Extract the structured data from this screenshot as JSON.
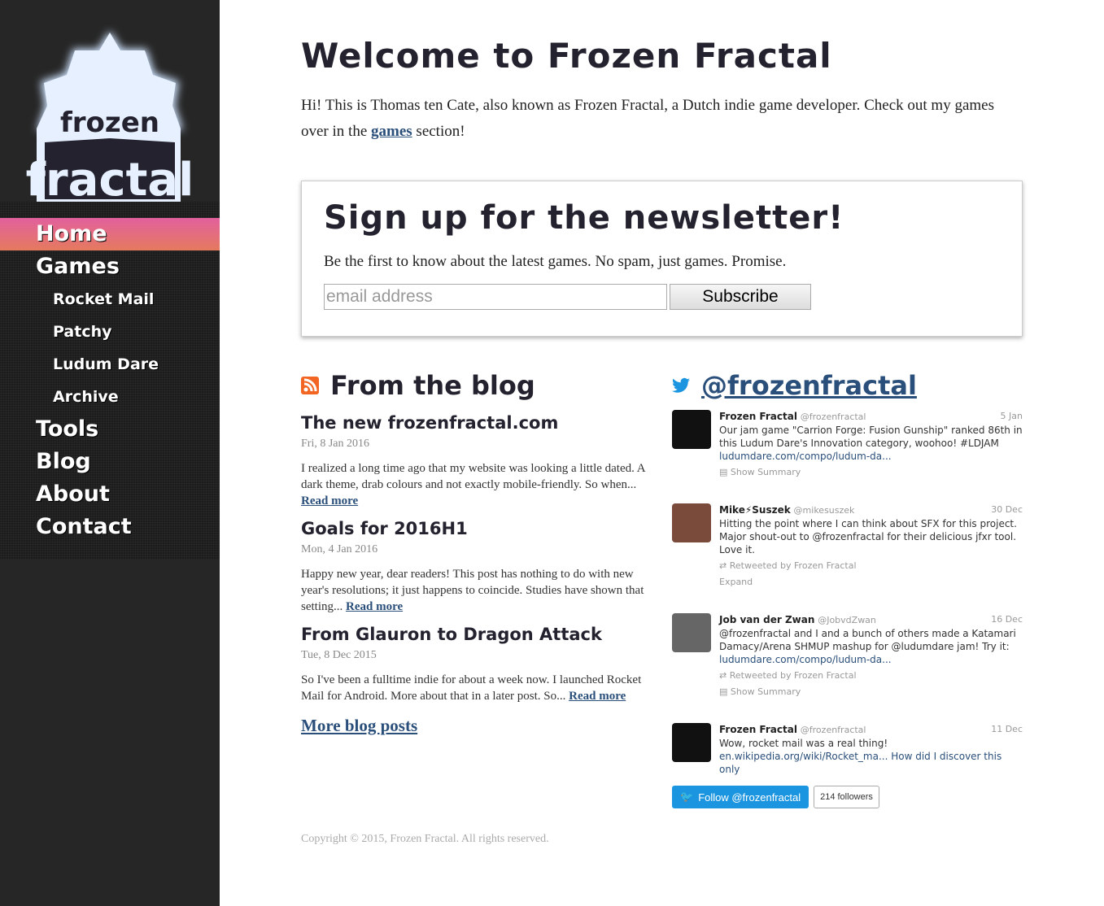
{
  "logo": {
    "line1": "frozen",
    "line2": "fractal"
  },
  "nav": {
    "items": [
      {
        "label": "Home",
        "active": true
      },
      {
        "label": "Games"
      },
      {
        "label": "Rocket Mail",
        "sub": true
      },
      {
        "label": "Patchy",
        "sub": true
      },
      {
        "label": "Ludum Dare",
        "sub": true
      },
      {
        "label": "Archive",
        "sub": true
      },
      {
        "label": "Tools"
      },
      {
        "label": "Blog"
      },
      {
        "label": "About"
      },
      {
        "label": "Contact"
      }
    ]
  },
  "page": {
    "title": "Welcome to Frozen Fractal",
    "intro_before": "Hi! This is Thomas ten Cate, also known as Frozen Fractal, a Dutch indie game developer. Check out my games over in the ",
    "intro_link": "games",
    "intro_after": " section!"
  },
  "newsletter": {
    "title": "Sign up for the newsletter!",
    "text": "Be the first to know about the latest games. No spam, just games. Promise.",
    "placeholder": "email address",
    "button": "Subscribe"
  },
  "blog": {
    "title": "From the blog",
    "posts": [
      {
        "title": "The new frozenfractal.com",
        "date": "Fri, 8 Jan 2016",
        "excerpt": "I realized a long time ago that my website was looking a little dated. A dark theme, drab colours and not exactly mobile-friendly. So when... ",
        "read_more": "Read more"
      },
      {
        "title": "Goals for 2016H1",
        "date": "Mon, 4 Jan 2016",
        "excerpt": "Happy new year, dear readers! This post has nothing to do with new year's resolutions; it just happens to coincide. Studies have shown that setting... ",
        "read_more": "Read more"
      },
      {
        "title": "From Glauron to Dragon Attack",
        "date": "Tue, 8 Dec 2015",
        "excerpt": "So I've been a fulltime indie for about a week now. I launched Rocket Mail for Android. More about that in a later post. So... ",
        "read_more": "Read more"
      }
    ],
    "more": "More blog posts"
  },
  "twitter": {
    "title": "@frozenfractal",
    "tweets": [
      {
        "name": "Frozen Fractal",
        "handle": "@frozenfractal",
        "date": "5 Jan",
        "text": "Our jam game \"Carrion Forge: Fusion Gunship\" ranked 86th in this Ludum Dare's Innovation category, woohoo! #LDJAM",
        "link": "ludumdare.com/compo/ludum-da...",
        "meta": "Show Summary"
      },
      {
        "name": "Mike⚡Suszek",
        "handle": "@mikesuszek",
        "date": "30 Dec",
        "text": "Hitting the point where I can think about SFX for this project. Major shout-out to @frozenfractal for their delicious jfxr tool. Love it.",
        "retweet": "Retweeted by Frozen Fractal",
        "meta": "Expand"
      },
      {
        "name": "Job van der Zwan",
        "handle": "@JobvdZwan",
        "date": "16 Dec",
        "text": "@frozenfractal and I and a bunch of others made a Katamari Damacy/Arena SHMUP mashup for @ludumdare jam! Try it:",
        "link": "ludumdare.com/compo/ludum-da...",
        "retweet": "Retweeted by Frozen Fractal",
        "meta": "Show Summary"
      },
      {
        "name": "Frozen Fractal",
        "handle": "@frozenfractal",
        "date": "11 Dec",
        "text": "Wow, rocket mail was a real thing!",
        "link": "en.wikipedia.org/wiki/Rocket_ma...  How did I discover this only"
      }
    ],
    "follow": "Follow @frozenfractal",
    "followers": "214 followers"
  },
  "footer": {
    "copyright": "Copyright © 2015, Frozen Fractal. All rights reserved."
  },
  "colors": {
    "accent": "#2a4f7a",
    "active_nav": "#e2609e",
    "twitter": "#1b95e0"
  }
}
